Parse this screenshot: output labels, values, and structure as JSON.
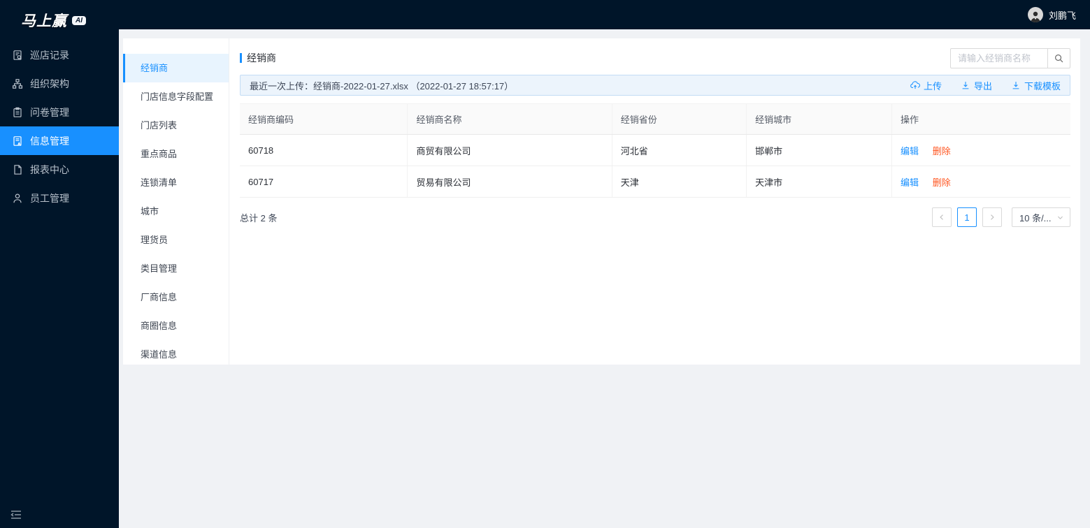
{
  "app": {
    "logo_text": "马上赢",
    "logo_badge": "AI",
    "user_name": "刘鹏飞"
  },
  "colors": {
    "sidebar_dark": "#001529",
    "accent_blue": "#1890ff",
    "delete_orange": "#ff5722",
    "submenu_active_bg": "#e8f4fe",
    "upload_bar_bg": "#ecf4fc"
  },
  "sidebar": {
    "items": [
      {
        "label": "巡店记录",
        "icon": "store-patrol-icon",
        "active": false
      },
      {
        "label": "组织架构",
        "icon": "org-structure-icon",
        "active": false
      },
      {
        "label": "问卷管理",
        "icon": "questionnaire-icon",
        "active": false
      },
      {
        "label": "信息管理",
        "icon": "info-management-icon",
        "active": true
      },
      {
        "label": "报表中心",
        "icon": "report-center-icon",
        "active": false
      },
      {
        "label": "员工管理",
        "icon": "employee-icon",
        "active": false
      }
    ]
  },
  "submenu": {
    "items": [
      {
        "label": "经销商",
        "active": true
      },
      {
        "label": "门店信息字段配置",
        "active": false
      },
      {
        "label": "门店列表",
        "active": false
      },
      {
        "label": "重点商品",
        "active": false
      },
      {
        "label": "连锁清单",
        "active": false
      },
      {
        "label": "城市",
        "active": false
      },
      {
        "label": "理货员",
        "active": false
      },
      {
        "label": "类目管理",
        "active": false
      },
      {
        "label": "厂商信息",
        "active": false
      },
      {
        "label": "商圈信息",
        "active": false
      },
      {
        "label": "渠道信息",
        "active": false
      }
    ]
  },
  "content": {
    "page_title": "经销商",
    "search_placeholder": "请输入经销商名称",
    "upload_bar": {
      "text": "最近一次上传：经销商-2022-01-27.xlsx （2022-01-27 18:57:17）",
      "upload_label": "上传",
      "export_label": "导出",
      "download_template_label": "下载模板"
    },
    "table": {
      "headers": [
        "经销商编码",
        "经销商名称",
        "经销省份",
        "经销城市",
        "操作"
      ],
      "rows": [
        {
          "code": "60718",
          "name": "商贸有限公司",
          "province": "河北省",
          "city": "邯郸市",
          "edit": "编辑",
          "delete": "删除"
        },
        {
          "code": "60717",
          "name": "贸易有限公司",
          "province": "天津",
          "city": "天津市",
          "edit": "编辑",
          "delete": "删除"
        }
      ]
    },
    "footer": {
      "total_text": "总计 2 条",
      "pagination": {
        "current_page": "1",
        "page_size_label": "10 条/..."
      }
    }
  }
}
